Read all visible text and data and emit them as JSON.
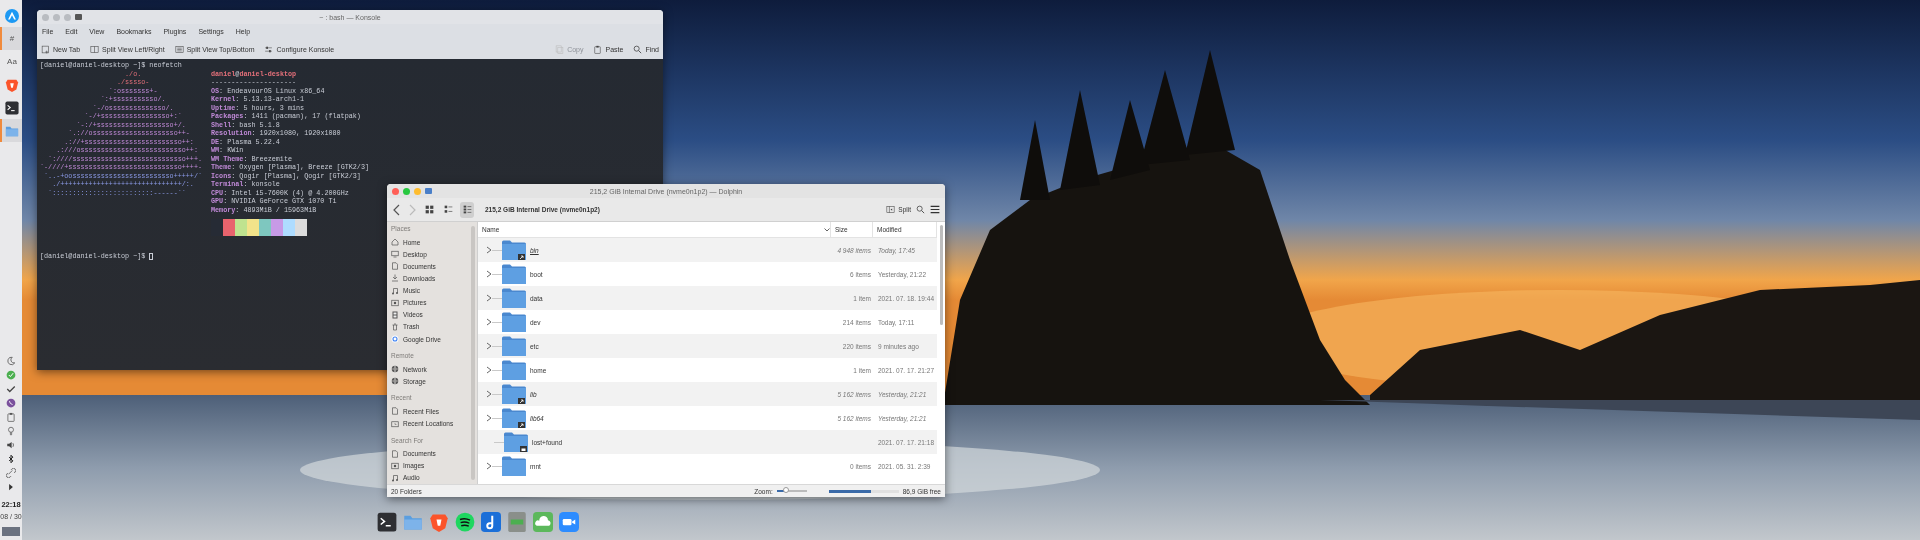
{
  "panel": {
    "items": [
      {
        "kind": "app",
        "active": false
      },
      {
        "kind": "glyph",
        "glyph": "#",
        "active": true
      },
      {
        "kind": "glyph",
        "glyph": "Aa",
        "active": false
      },
      {
        "kind": "app",
        "active": false
      },
      {
        "kind": "app",
        "active": false
      },
      {
        "kind": "app",
        "active": true
      }
    ],
    "clock": "22:18",
    "date": "08 / 30"
  },
  "konsole": {
    "title": "~ : bash — Konsole",
    "active": false,
    "menu": [
      "File",
      "Edit",
      "View",
      "Bookmarks",
      "Plugins",
      "Settings",
      "Help"
    ],
    "toolbar": [
      {
        "label": "New Tab",
        "disabled": false
      },
      {
        "label": "Split View Left/Right",
        "disabled": false
      },
      {
        "label": "Split View Top/Bottom",
        "disabled": false
      },
      {
        "label": "Configure Konsole",
        "disabled": false
      }
    ],
    "toolbar_right": [
      {
        "label": "Copy",
        "disabled": true
      },
      {
        "label": "Paste",
        "disabled": false
      },
      {
        "label": "Find",
        "disabled": false
      }
    ],
    "terminal": {
      "prompt": "[daniel@daniel-desktop ~]$ neofetch",
      "logo": [
        "                     ./o.",
        "                   ./sssso-",
        "                 `:osssssss+-",
        "               `:+sssssssssso/.",
        "             `-/ossssssssssssso/.",
        "           `-/+sssssssssssssssso+:`",
        "         `-:/+sssssssssssssssssso+/.",
        "       `.://osssssssssssssssssssso++-",
        "      .://+ssssssssssssssssssssssso++:",
        "    .:///ossssssssssssssssssssssssso++:",
        "  `:////ssssssssssssssssssssssssssso+++.",
        "`-////+ssssssssssssssssssssssssssso++++-",
        " `..-+oosssssssssssssssssssssssso+++++/`",
        "   ./++++++++++++++++++++++++++++++/:.",
        "  `:::::::::::::::::::::::::------``"
      ],
      "user": "**daniel**@**daniel-desktop**",
      "separator": "---------------------",
      "info": [
        "**OS**: EndeavourOS Linux x86_64",
        "**Kernel**: 5.13.13-arch1-1",
        "**Uptime**: 5 hours, 3 mins",
        "**Packages**: 1411 (pacman), 17 (flatpak)",
        "**Shell**: bash 5.1.8",
        "**Resolution**: 1920x1080, 1920x1080",
        "**DE**: Plasma 5.22.4",
        "**WM**: KWin",
        "**WM Theme**: Breezemite",
        "**Theme**: Oxygen [Plasma], Breeze [GTK2/3]",
        "**Icons**: Qogir [Plasma], Qogir [GTK2/3]",
        "**Terminal**: konsole",
        "**CPU**: Intel i5-7600K (4) @ 4.200GHz",
        "**GPU**: NVIDIA GeForce GTX 1070 Ti",
        "**Memory**: 4893MiB / 15963MiB"
      ],
      "palette": [
        {
          "color": "#262b35"
        },
        {
          "color": "#e8636d"
        },
        {
          "color": "#bfe38f"
        },
        {
          "color": "#f2e38a"
        },
        {
          "color": "#7ec7bf"
        },
        {
          "color": "#c79ae6"
        },
        {
          "color": "#aedcff"
        },
        {
          "color": "#dcdcdc"
        }
      ],
      "prompt2": "[daniel@daniel-desktop ~]$"
    }
  },
  "dolphin": {
    "title": "215,2 GiB Internal Drive (nvme0n1p2) — Dolphin",
    "active": true,
    "back_enabled": true,
    "forward_enabled": false,
    "view_modes": [
      {
        "selected": false
      },
      {
        "selected": false
      },
      {
        "selected": true
      }
    ],
    "breadcrumb": "215,2 GiB Internal Drive (nvme0n1p2)",
    "split_label": "Split",
    "sidebar": [
      {
        "heading": "Places",
        "items": [
          "Home",
          "Desktop",
          "Documents",
          "Downloads",
          "Music",
          "Pictures",
          "Videos",
          "Trash",
          "Google Drive"
        ]
      },
      {
        "heading": "Remote",
        "items": [
          "Network",
          "Storage"
        ]
      },
      {
        "heading": "Recent",
        "items": [
          "Recent Files",
          "Recent Locations"
        ]
      },
      {
        "heading": "Search For",
        "items": [
          "Documents",
          "Images",
          "Audio"
        ]
      }
    ],
    "columns": [
      {
        "label": "Name",
        "sorted": true
      },
      {
        "label": "Size",
        "sorted": false
      },
      {
        "label": "Modified",
        "sorted": false
      }
    ],
    "rows": [
      {
        "name": "bin",
        "size": "4 948 items",
        "modified": "Today, 17:45",
        "symlink": true,
        "locked": false,
        "expandable": true,
        "hovered": true
      },
      {
        "name": "boot",
        "size": "6 items",
        "modified": "Yesterday, 21:22",
        "symlink": false,
        "locked": false,
        "expandable": true,
        "hovered": false
      },
      {
        "name": "data",
        "size": "1 item",
        "modified": "2021. 07. 18. 19:44",
        "symlink": false,
        "locked": false,
        "expandable": true,
        "hovered": false
      },
      {
        "name": "dev",
        "size": "214 items",
        "modified": "Today, 17:11",
        "symlink": false,
        "locked": false,
        "expandable": true,
        "hovered": false
      },
      {
        "name": "etc",
        "size": "220 items",
        "modified": "9 minutes ago",
        "symlink": false,
        "locked": false,
        "expandable": true,
        "hovered": false
      },
      {
        "name": "home",
        "size": "1 item",
        "modified": "2021. 07. 17. 21:27",
        "symlink": false,
        "locked": false,
        "expandable": true,
        "hovered": false
      },
      {
        "name": "lib",
        "size": "5 162 items",
        "modified": "Yesterday, 21:21",
        "symlink": true,
        "locked": false,
        "expandable": true,
        "hovered": false
      },
      {
        "name": "lib64",
        "size": "5 162 items",
        "modified": "Yesterday, 21:21",
        "symlink": true,
        "locked": false,
        "expandable": true,
        "hovered": false
      },
      {
        "name": "lost+found",
        "modified": "2021. 07. 17. 21:18",
        "symlink": false,
        "locked": true,
        "expandable": false,
        "hovered": false
      },
      {
        "name": "mnt",
        "size": "0 items",
        "modified": "2021. 05. 31. 2:39",
        "symlink": false,
        "locked": false,
        "expandable": true,
        "hovered": false
      }
    ],
    "status": "20 Folders",
    "zoom_label": "Zoom:",
    "zoom": {
      "level": 0.3
    },
    "space": {
      "level": 0.6,
      "label": "86,9 GiB free"
    }
  }
}
